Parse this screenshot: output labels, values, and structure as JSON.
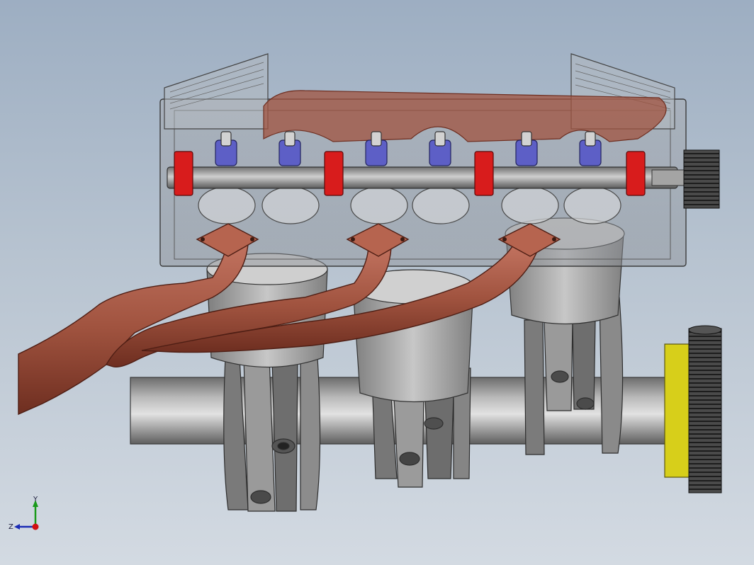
{
  "viewport": {
    "background_top": "#9daec2",
    "background_bottom": "#d3dae2"
  },
  "model": {
    "colors": {
      "metal": "#8d8d8d",
      "metal_dark": "#4a4a4a",
      "exhaust": "#a0533f",
      "exhaust_dark": "#6e2e20",
      "bearing_cap": "#d81c1c",
      "rocker": "#5d5fc6",
      "pulley_yellow": "#d7cf1a"
    }
  },
  "triad": {
    "y_label": "Y",
    "z_label": "Z",
    "icon": "view-triad-icon"
  }
}
